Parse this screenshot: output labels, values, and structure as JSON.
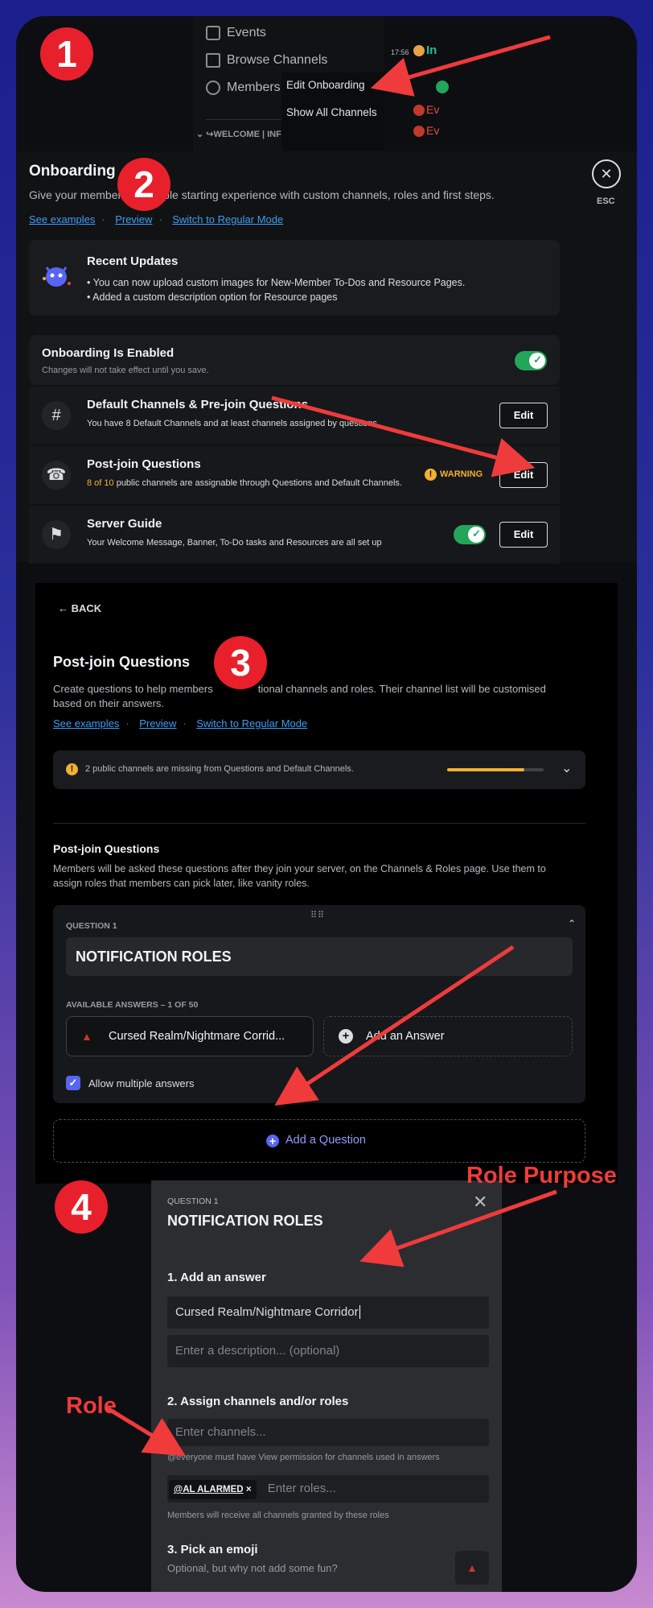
{
  "colors": {
    "accent_red": "#e8202c",
    "annotation_red": "#ef3b3b",
    "link_blue": "#3e9ef5",
    "toggle_green": "#23a55a",
    "warning_orange": "#f0b232",
    "brand_blurple": "#5865f2"
  },
  "steps": [
    "1",
    "2",
    "3",
    "4"
  ],
  "panel1": {
    "sidebar_items": [
      {
        "label": "Events",
        "icon": "calendar-icon"
      },
      {
        "label": "Browse Channels",
        "icon": "hashtag-search-icon"
      },
      {
        "label": "Members",
        "icon": "members-icon"
      }
    ],
    "category": "↪WELCOME | INFO",
    "context_menu": [
      "Edit Onboarding",
      "Show All Channels"
    ],
    "chat_time": "17:56",
    "chat_snippets": [
      "In",
      "Ev",
      "Ev"
    ]
  },
  "panel2": {
    "title": "Onboarding",
    "subtitle": "Give your members a simple starting experience with custom channels, roles and first steps.",
    "subtitle_pre": "Give your member",
    "subtitle_post": "ple starting experience with custom channels, roles and first steps.",
    "links": [
      "See examples",
      "Preview",
      "Switch to Regular Mode"
    ],
    "esc_label": "ESC",
    "updates": {
      "title": "Recent Updates",
      "lines": [
        "• You can now upload custom images for New-Member To-Dos and Resource Pages.",
        "• Added a custom description option for Resource pages"
      ]
    },
    "enabled": {
      "title": "Onboarding Is Enabled",
      "sub": "Changes will not take effect until you save."
    },
    "rows": [
      {
        "title": "Default Channels & Pre-join Questions",
        "sub": "You have 8 Default Channels and at least channels assigned by questions.",
        "button": "Edit",
        "icon": "hashtag-icon"
      },
      {
        "title": "Post-join Questions",
        "sub_count": "8 of 10",
        "sub": " public channels are assignable through Questions and Default Channels.",
        "warning": "WARNING",
        "button": "Edit",
        "icon": "person-add-icon"
      },
      {
        "title": "Server Guide",
        "sub": "Your Welcome Message, Banner, To-Do tasks and Resources are all set up",
        "button": "Edit",
        "icon": "signpost-icon"
      }
    ]
  },
  "panel3": {
    "back": "BACK",
    "title": "Post-join Questions",
    "desc_pre": "Create questions to help members",
    "desc_post": "tional channels and roles. Their channel list will be customised",
    "desc_line2": "based on their answers.",
    "links": [
      "See examples",
      "Preview",
      "Switch to Regular Mode"
    ],
    "alert": "2 public channels are missing from Questions and Default Channels.",
    "progress": 0.8,
    "section_title": "Post-join Questions",
    "section_desc": [
      "Members will be asked these questions after they join your server, on the Channels & Roles page. Use them to",
      "assign roles that members can pick later, like vanity roles."
    ],
    "question_label": "QUESTION 1",
    "question_title": "NOTIFICATION ROLES",
    "answers_label": "AVAILABLE ANSWERS – 1 OF 50",
    "answer": "Cursed Realm/Nightmare Corrid...",
    "add_answer": "Add an Answer",
    "allow_multiple": "Allow multiple answers",
    "add_question": "Add a Question"
  },
  "panel4": {
    "question_label": "QUESTION 1",
    "question_title": "NOTIFICATION ROLES",
    "step1": "1. Add an answer",
    "answer_value": "Cursed Realm/Nightmare Corridor",
    "desc_placeholder": "Enter a description... (optional)",
    "step2": "2. Assign channels and/or roles",
    "channels_placeholder": "Enter channels...",
    "channels_note": "@everyone must have View permission for channels used in answers",
    "role_tag": "@AL ALARMED",
    "roles_placeholder": "Enter roles...",
    "roles_note": "Members will receive all channels granted by these roles",
    "step3": "3. Pick an emoji",
    "step3_sub": "Optional, but why not add some fun?"
  },
  "annotations": {
    "role_purpose": "Role Purpose",
    "role": "Role"
  }
}
